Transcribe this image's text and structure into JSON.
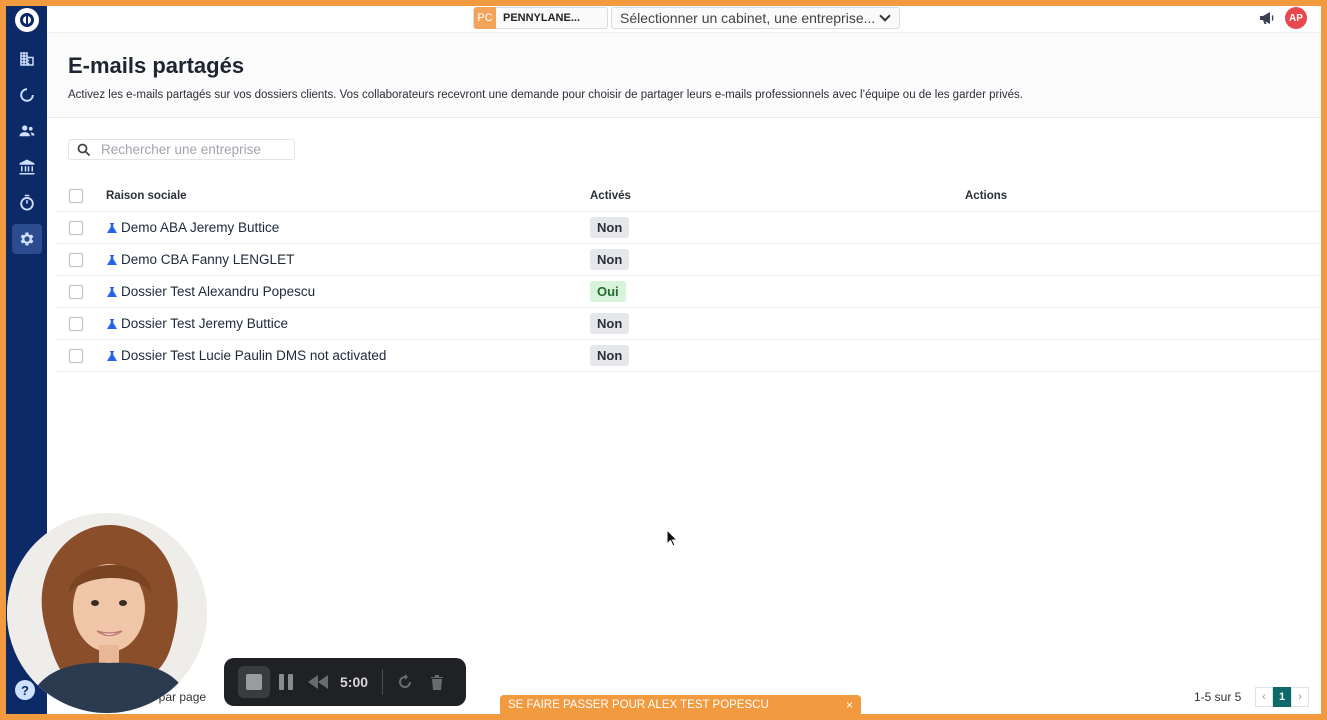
{
  "topbar": {
    "company_badge": "PC",
    "company_name": "PENNYLANE...",
    "cabinet_select_value": "Sélectionner un cabinet, une entreprise...",
    "user_initials": "AP"
  },
  "page": {
    "title": "E-mails partagés",
    "description": "Activez les e-mails partagés sur vos dossiers clients. Vos collaborateurs recevront une demande pour choisir de partager leurs e-mails professionnels avec l’équipe ou de les garder privés."
  },
  "search": {
    "placeholder": "Rechercher une entreprise"
  },
  "table": {
    "headers": {
      "name": "Raison sociale",
      "active": "Activés",
      "actions": "Actions"
    },
    "rows": [
      {
        "name": "Demo ABA Jeremy Buttice",
        "active": "Non"
      },
      {
        "name": "Demo CBA Fanny LENGLET",
        "active": "Non"
      },
      {
        "name": "Dossier Test Alexandru Popescu",
        "active": "Oui"
      },
      {
        "name": "Dossier Test Jeremy Buttice",
        "active": "Non"
      },
      {
        "name": "Dossier Test Lucie Paulin DMS not activated",
        "active": "Non"
      }
    ]
  },
  "footer": {
    "per_page_label": "ts par page",
    "pagination_info": "1-5 sur 5",
    "current_page": "1",
    "prev": "‹",
    "next": "›"
  },
  "impersonation_bar": {
    "text": "SE FAIRE PASSER POUR ALEX TEST POPESCU",
    "close": "×"
  },
  "recorder": {
    "time": "5:00"
  },
  "sidebar": {
    "help": "?"
  },
  "colors": {
    "sidebar": "#0b2a66",
    "accent_frame": "#f29a3f",
    "yes_badge": "#d7f3d9",
    "no_badge": "#e5e7eb",
    "page_active": "#0e6a6a"
  }
}
